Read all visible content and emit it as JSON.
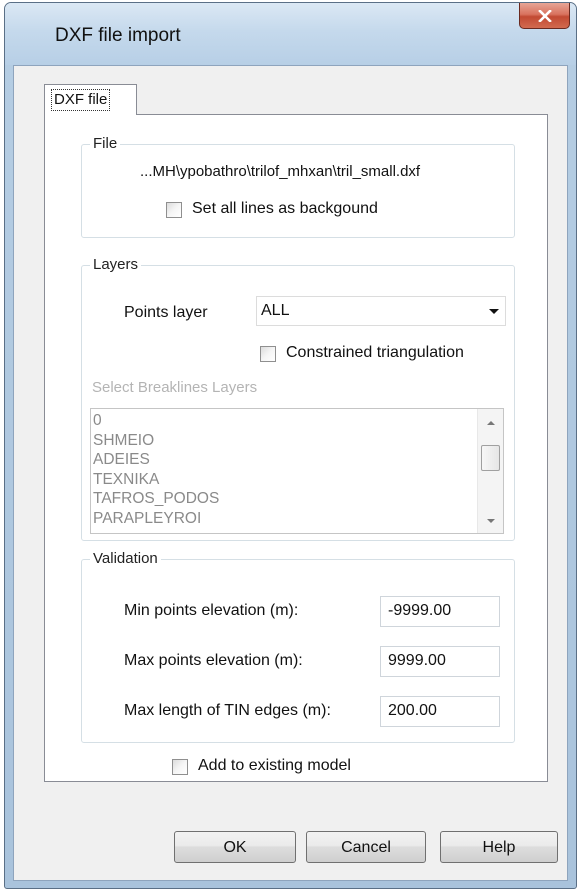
{
  "window": {
    "title": "DXF file import",
    "close_glyph": "✕"
  },
  "tabs": [
    {
      "label": "DXF file",
      "selected": true
    }
  ],
  "file_group": {
    "title": "File",
    "path": "...MH\\ypobathro\\trilof_mhxan\\tril_small.dxf",
    "set_background_label": "Set all lines as backgound",
    "set_background_checked": false
  },
  "layers_group": {
    "title": "Layers",
    "points_layer_label": "Points layer",
    "points_layer_value": "ALL",
    "constrained_label": "Constrained triangulation",
    "constrained_checked": false,
    "breaklines_label": "Select Breaklines Layers",
    "breakline_layers": [
      "0",
      "SHMEIO",
      "ADEIES",
      "TEXNIKA",
      "TAFROS_PODOS",
      "PARAPLEYROI"
    ]
  },
  "validation_group": {
    "title": "Validation",
    "min_label": "Min points elevation (m):",
    "min_value": "-9999.00",
    "max_label": "Max points elevation (m):",
    "max_value": "9999.00",
    "tin_label": "Max length of TIN edges (m):",
    "tin_value": "200.00"
  },
  "add_existing": {
    "label": "Add to existing model",
    "checked": false
  },
  "buttons": {
    "ok": "OK",
    "cancel": "Cancel",
    "help": "Help"
  },
  "colors": {
    "title_bar": "#c5d9ec",
    "close_button": "#c24a33",
    "disabled_text": "#8a8a8a"
  },
  "icons": {
    "close": "close-icon",
    "combo": "chevron-down-icon",
    "scroll_up": "arrow-up-icon",
    "scroll_down": "arrow-down-icon"
  }
}
